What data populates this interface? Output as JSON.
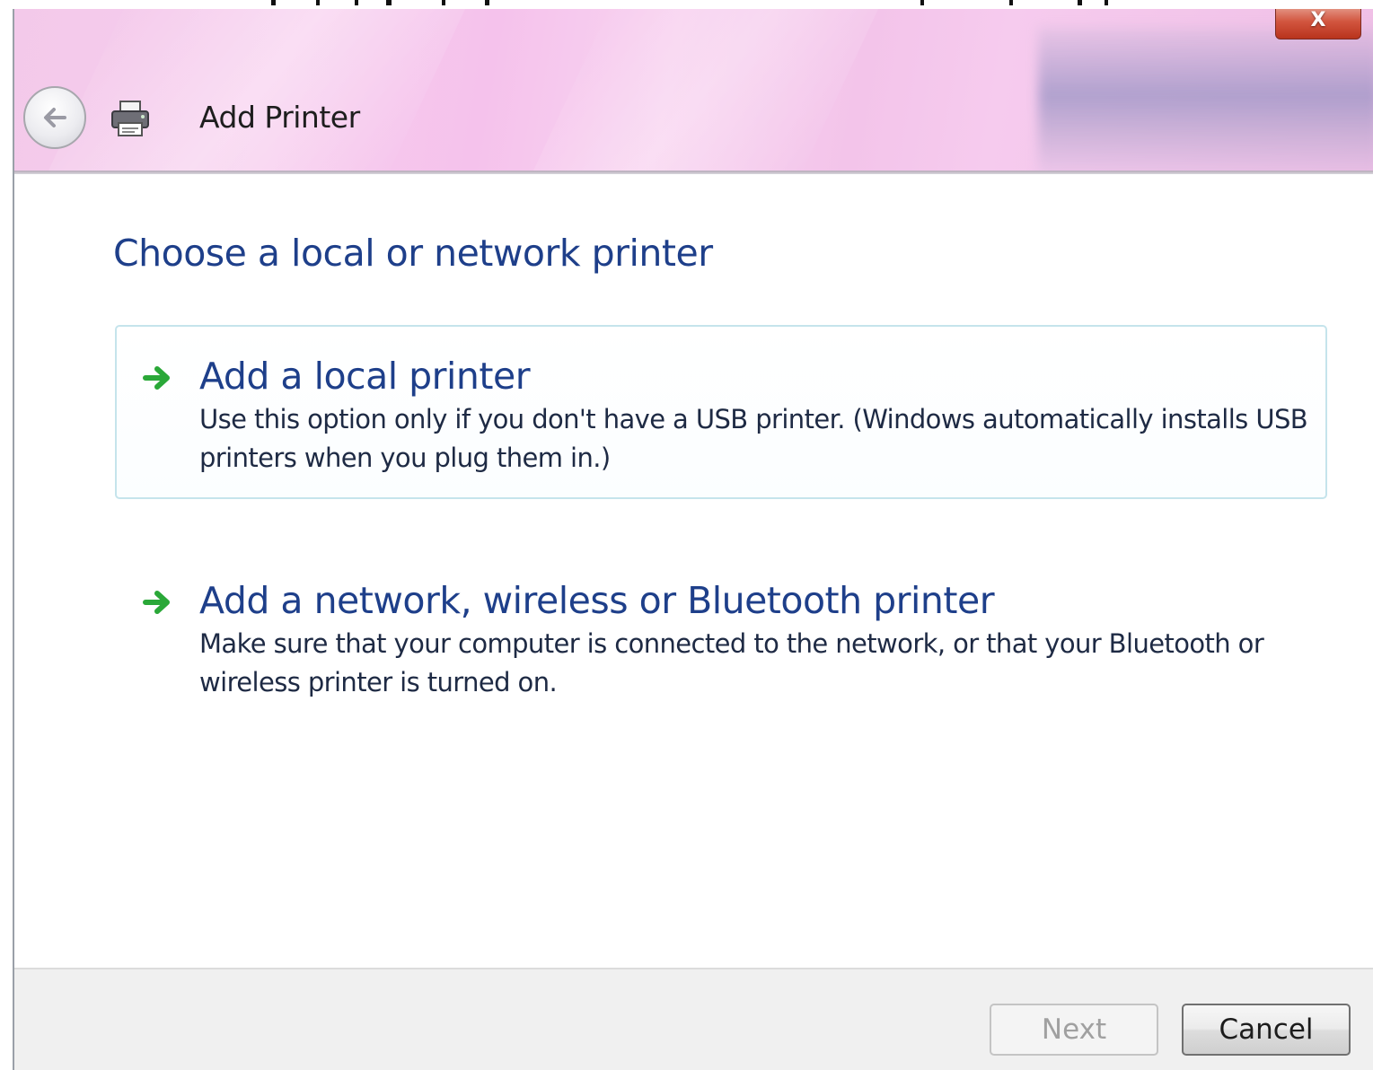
{
  "window": {
    "title": "Add Printer",
    "close_label": "X"
  },
  "content": {
    "heading": "Choose a local or network printer",
    "options": [
      {
        "title": "Add a local printer",
        "description": "Use this option only if you don't have a USB printer. (Windows automatically installs USB printers when you plug them in.)",
        "selected": true
      },
      {
        "title": "Add a network, wireless or Bluetooth printer",
        "description": "Make sure that your computer is connected to the network, or that your Bluetooth or wireless printer is turned on.",
        "selected": false
      }
    ]
  },
  "footer": {
    "next_label": "Next",
    "next_enabled": false,
    "cancel_label": "Cancel"
  },
  "icons": {
    "back": "back-arrow-icon",
    "window": "printer-icon",
    "option_arrow": "green-arrow-icon",
    "close": "close-icon"
  },
  "colors": {
    "heading": "#1e3f8a",
    "titlebar": "#f5c6ec",
    "option_arrow": "#2aa838",
    "selected_border": "#c5e4ec"
  }
}
